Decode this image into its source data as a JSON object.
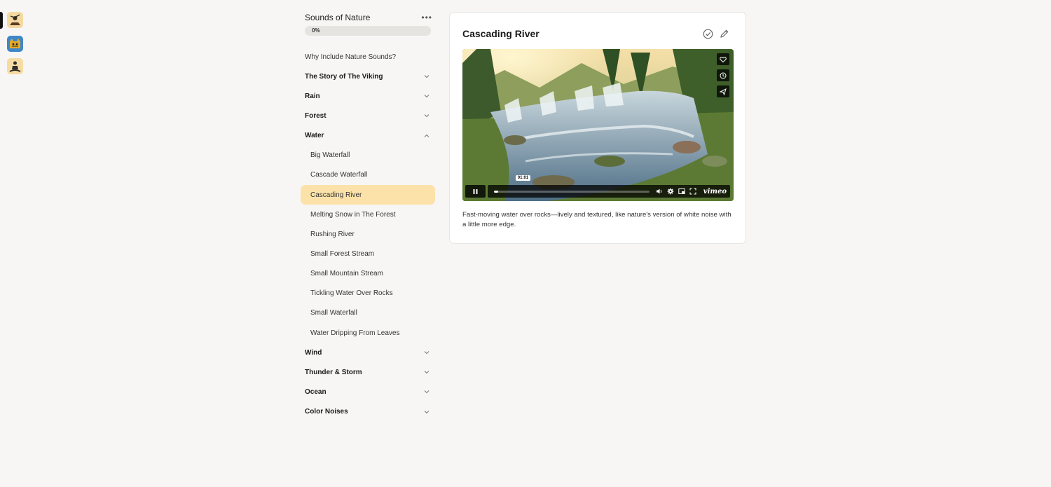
{
  "rail": {
    "apps": [
      {
        "icon": "viking-app-icon"
      },
      {
        "icon": "cat-app-icon"
      },
      {
        "icon": "meditation-app-icon"
      }
    ]
  },
  "course": {
    "title": "Sounds of Nature",
    "progress_text": "0%",
    "progress_value": 0
  },
  "nav": {
    "intro": "Why Include Nature Sounds?",
    "sections_before": [
      {
        "label": "The Story of The Viking"
      },
      {
        "label": "Rain"
      },
      {
        "label": "Forest"
      }
    ],
    "open_section": {
      "label": "Water",
      "lessons": [
        {
          "label": "Big Waterfall"
        },
        {
          "label": "Cascade Waterfall"
        },
        {
          "label": "Cascading River"
        },
        {
          "label": "Melting Snow in The Forest"
        },
        {
          "label": "Rushing River"
        },
        {
          "label": "Small Forest Stream"
        },
        {
          "label": "Small Mountain Stream"
        },
        {
          "label": "Tickling Water Over Rocks"
        },
        {
          "label": "Small Waterfall"
        },
        {
          "label": "Water Dripping From Leaves"
        }
      ]
    },
    "sections_after": [
      {
        "label": "Wind"
      },
      {
        "label": "Thunder & Storm"
      },
      {
        "label": "Ocean"
      },
      {
        "label": "Color Noises"
      }
    ]
  },
  "lesson": {
    "title": "Cascading River",
    "video": {
      "time_tooltip": "01:01",
      "progress_fraction": 0.03,
      "brand": "vimeo"
    },
    "description": "Fast-moving water over rocks—lively and textured, like nature's version of white noise with a little more edge."
  },
  "colors": {
    "active_item": "#fce2a9",
    "background": "#f7f6f4"
  }
}
